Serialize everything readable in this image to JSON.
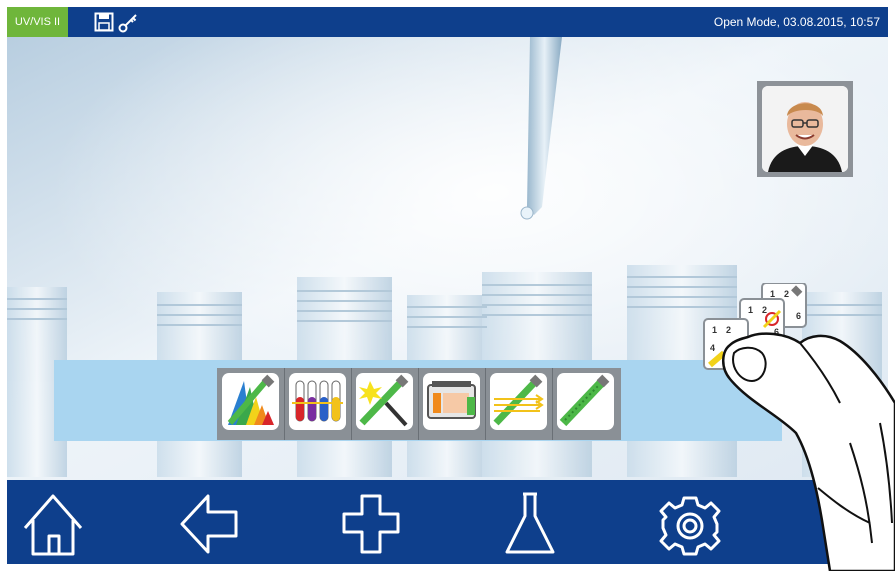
{
  "status_bar": {
    "device_label": "UV/VIS II",
    "mode_datetime": "Open Mode, 03.08.2015, 10:57",
    "icons": [
      "save-icon",
      "key-icon"
    ]
  },
  "avatar": {
    "icon": "user-photo"
  },
  "method_bar": {
    "items": [
      {
        "icon": "spectrum-scan-icon"
      },
      {
        "icon": "multi-wavelength-tubes-icon"
      },
      {
        "icon": "kinetics-flash-icon"
      },
      {
        "icon": "multi-cell-icon"
      },
      {
        "icon": "single-wavelength-icon"
      },
      {
        "icon": "quantification-icon"
      }
    ]
  },
  "stacked_cards": {
    "visible_numbers": [
      "1",
      "2",
      "6",
      "1",
      "2",
      "6",
      "1",
      "2",
      "4"
    ]
  },
  "nav_bar": {
    "items": [
      {
        "icon": "home-icon"
      },
      {
        "icon": "back-arrow-icon"
      },
      {
        "icon": "add-icon"
      },
      {
        "icon": "flask-icon"
      },
      {
        "icon": "settings-gear-icon"
      }
    ]
  },
  "colors": {
    "bar_blue": "#0e3f8c",
    "device_green": "#6fb63b",
    "launcher_light_blue": "#a9d5f0",
    "launcher_strip_grey": "#8a9096"
  }
}
